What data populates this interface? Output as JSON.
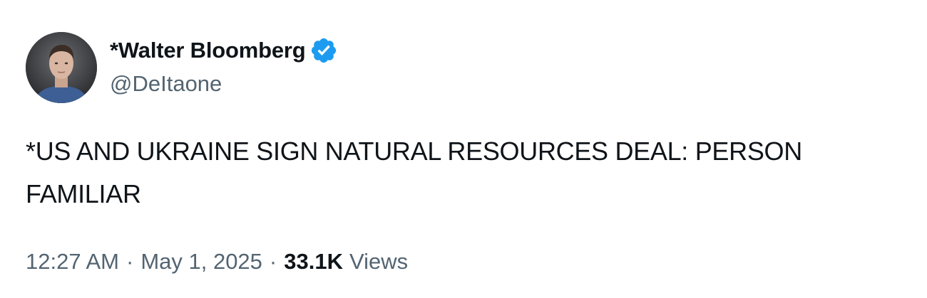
{
  "author": {
    "display_name": "*Walter Bloomberg",
    "handle": "@DeItaone",
    "verified": true,
    "verified_color": "#1d9bf0",
    "avatar_icon": "profile-photo"
  },
  "tweet": {
    "text": "*US AND UKRAINE SIGN NATURAL RESOURCES DEAL: PERSON FAMILIAR"
  },
  "meta": {
    "time": "12:27 AM",
    "separator": "·",
    "date": "May 1, 2025",
    "views_count": "33.1K",
    "views_label": "Views"
  }
}
